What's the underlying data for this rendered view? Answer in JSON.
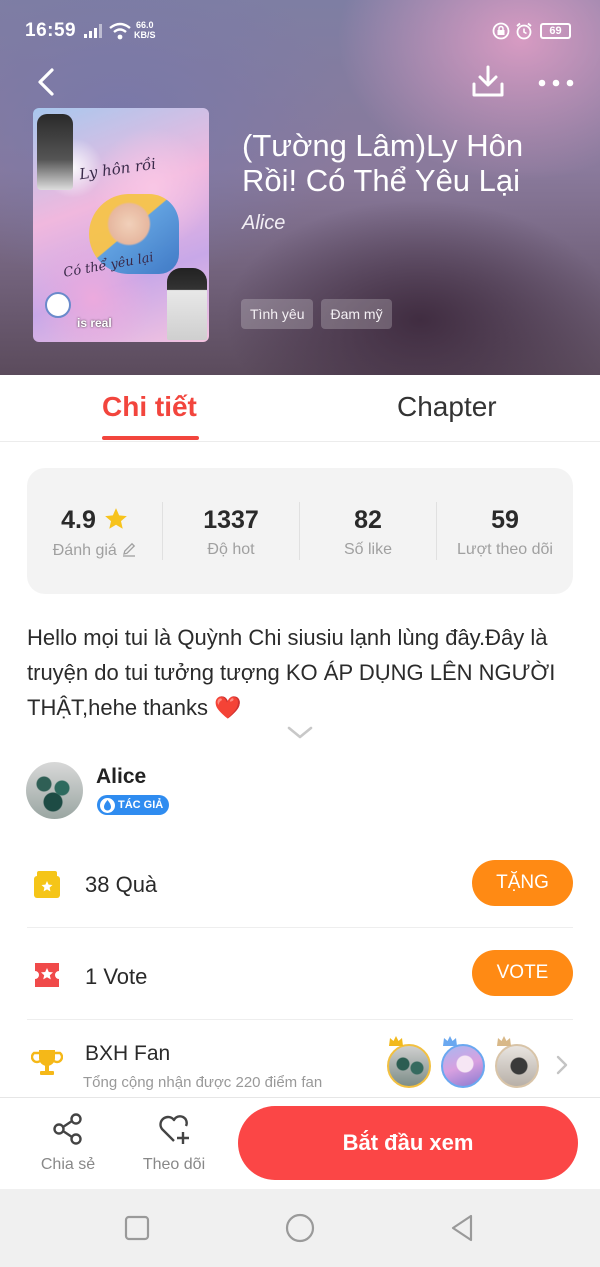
{
  "status_bar": {
    "time": "16:59",
    "network_speed_value": "66.0",
    "network_speed_unit": "KB/S",
    "battery": "69"
  },
  "book": {
    "title": "(Tường Lâm)Ly Hôn Rồi! Có Thể Yêu Lại",
    "author": "Alice",
    "tags": [
      "Tình yêu",
      "Đam mỹ"
    ],
    "cover": {
      "line1": "Ly hôn rồi",
      "line2": "Có thể yêu lại",
      "caption": "is real"
    }
  },
  "tabs": {
    "details": "Chi tiết",
    "chapter": "Chapter",
    "active": "details"
  },
  "stats": {
    "rating": {
      "value": "4.9",
      "label": "Đánh giá"
    },
    "hot": {
      "value": "1337",
      "label": "Độ hot"
    },
    "likes": {
      "value": "82",
      "label": "Số like"
    },
    "followers": {
      "value": "59",
      "label": "Lượt theo dõi"
    }
  },
  "description": "Hello mọi tui là Quỳnh Chi siusiu lạnh lùng đây.Đây là truyện do tui tưởng tượng KO ÁP DỤNG LÊN NGƯỜI THẬT,hehe thanks ❤️",
  "author_card": {
    "name": "Alice",
    "badge": "TÁC GIẢ"
  },
  "gift_row": {
    "label": "38  Quà",
    "button": "TẶNG"
  },
  "vote_row": {
    "label": "1  Vote",
    "button": "VOTE"
  },
  "fan_row": {
    "label": "BXH Fan",
    "sub": "Tổng cộng nhận được 220 điểm fan"
  },
  "bottom_bar": {
    "share": "Chia sẻ",
    "follow": "Theo dõi",
    "start": "Bắt đầu xem"
  },
  "colors": {
    "accent_red": "#f2453d",
    "button_orange": "#ff8a14",
    "start_red": "#fb4646",
    "badge_blue": "#2f8cf0",
    "gift_yellow": "#f5c518",
    "vote_red": "#f04a4a"
  }
}
